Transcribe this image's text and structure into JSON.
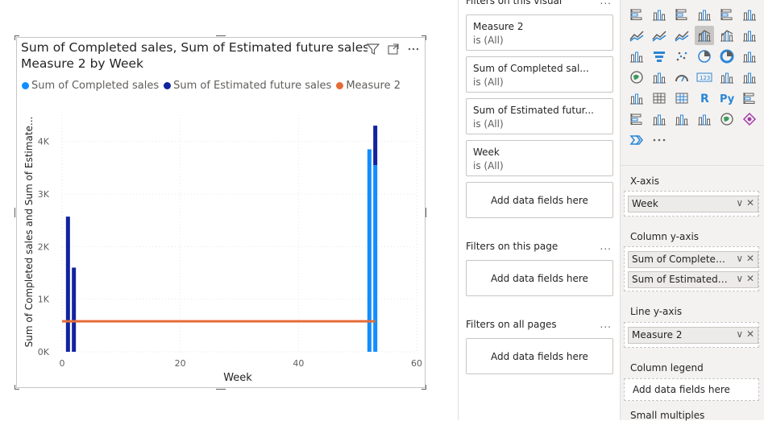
{
  "visual": {
    "title_line1": "Sum of Completed sales, Sum of Estimated future sales and",
    "title_line2": "Measure 2 by Week",
    "legend": [
      {
        "label": "Sum of Completed sales",
        "color": "#118DFF"
      },
      {
        "label": "Sum of Estimated future sales",
        "color": "#12239E"
      },
      {
        "label": "Measure 2",
        "color": "#E66C37"
      }
    ],
    "icons": [
      "filter-icon",
      "focus-mode-icon",
      "more-options-icon"
    ]
  },
  "chart_data": {
    "type": "bar",
    "xlabel": "Week",
    "ylabel": "Sum of Completed sales and Sum of Estimate...",
    "x_ticks": [
      "0",
      "20",
      "40",
      "60"
    ],
    "y_ticks": [
      "0K",
      "1K",
      "2K",
      "3K",
      "4K"
    ],
    "xlim": [
      0,
      60
    ],
    "ylim": [
      0,
      4500
    ],
    "grid": true,
    "series": [
      {
        "name": "Sum of Completed sales",
        "color": "#118DFF",
        "points": [
          {
            "x": 52,
            "y": 3850
          },
          {
            "x": 53,
            "y": 3550
          }
        ]
      },
      {
        "name": "Sum of Estimated future sales",
        "color": "#12239E",
        "points": [
          {
            "x": 1,
            "y": 2570
          },
          {
            "x": 2,
            "y": 1600
          },
          {
            "x": 53,
            "y": 750
          }
        ]
      },
      {
        "name": "Measure 2",
        "type": "line",
        "color": "#E66C37",
        "points": [
          {
            "x": 0,
            "y": 580
          },
          {
            "x": 53,
            "y": 580
          }
        ]
      }
    ]
  },
  "filters": {
    "visual_header": "Filters on this visual",
    "visual_cards": [
      {
        "name": "Measure 2",
        "state": "is (All)"
      },
      {
        "name": "Sum of Completed sal...",
        "state": "is (All)"
      },
      {
        "name": "Sum of Estimated futur...",
        "state": "is (All)"
      },
      {
        "name": "Week",
        "state": "is (All)"
      }
    ],
    "add_label": "Add data fields here",
    "page_header": "Filters on this page",
    "all_pages_header": "Filters on all pages",
    "more": "..."
  },
  "visualizations": {
    "icons": [
      "stacked-bar-icon",
      "stacked-column-icon",
      "clustered-bar-icon",
      "clustered-column-icon",
      "100-bar-icon",
      "100-column-icon",
      "line-chart-icon",
      "area-chart-icon",
      "stacked-area-icon",
      "line-clustered-column-icon",
      "line-stacked-column-icon",
      "ribbon-chart-icon",
      "waterfall-icon",
      "funnel-icon",
      "scatter-icon",
      "pie-icon",
      "donut-icon",
      "treemap-icon",
      "map-icon",
      "filled-map-icon",
      "gauge-icon",
      "card-icon",
      "multi-row-card-icon",
      "kpi-icon",
      "slicer-icon",
      "table-icon",
      "matrix-icon",
      "r-visual-icon",
      "python-visual-icon",
      "key-influencers-icon",
      "decomposition-tree-icon",
      "qa-icon",
      "smart-narrative-icon",
      "paginated-report-icon",
      "arcgis-icon",
      "power-apps-icon",
      "power-automate-icon",
      "more-visuals-icon"
    ],
    "xaxis_label": "X-axis",
    "xaxis_field": "Week",
    "col_y_label": "Column y-axis",
    "col_y_fields": [
      "Sum of Completed sal...",
      "Sum of Estimated fut..."
    ],
    "line_y_label": "Line y-axis",
    "line_y_field": "Measure 2",
    "legend_label": "Column legend",
    "add_label": "Add data fields here",
    "small_multiples_label": "Small multiples",
    "pill_controls": "∨ ✕"
  }
}
